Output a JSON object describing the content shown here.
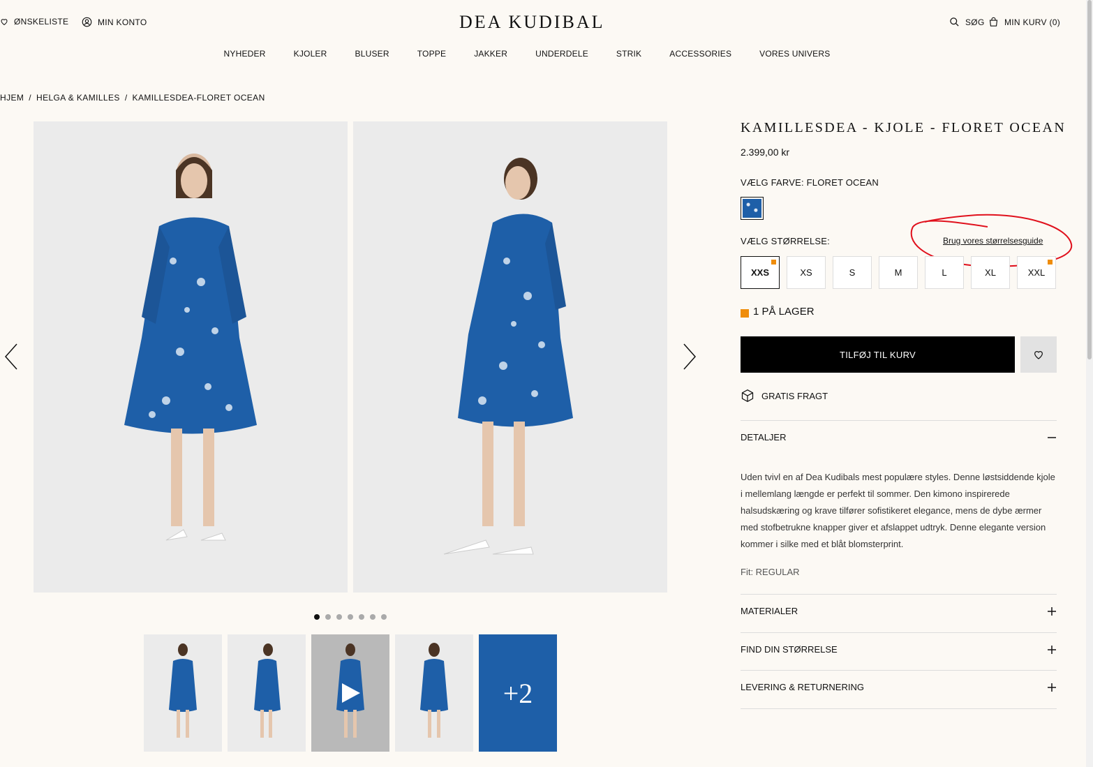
{
  "header": {
    "wishlist": "ØNSKELISTE",
    "account": "MIN KONTO",
    "logo": "DEA KUDIBAL",
    "search": "SØG",
    "cart": "MIN KURV (0)"
  },
  "nav": [
    "NYHEDER",
    "KJOLER",
    "BLUSER",
    "TOPPE",
    "JAKKER",
    "UNDERDELE",
    "STRIK",
    "ACCESSORIES",
    "VORES UNIVERS"
  ],
  "breadcrumb": [
    "HJEM",
    "HELGA & KAMILLES",
    "KAMILLESDEA-FLORET OCEAN"
  ],
  "gallery": {
    "total_dots": 7,
    "active_dot": 0,
    "more_count": "+2",
    "dress_color": "#1e5fa8"
  },
  "product": {
    "title": "KAMILLESDEA - KJOLE - FLORET OCEAN",
    "price": "2.399,00 kr",
    "color_label": "VÆLG FARVE: FLORET OCEAN",
    "size_label": "VÆLG STØRRELSE:",
    "size_guide": "Brug vores størrelsesguide",
    "sizes": [
      {
        "label": "XXS",
        "selected": true,
        "low_stock": true
      },
      {
        "label": "XS",
        "selected": false,
        "low_stock": false
      },
      {
        "label": "S",
        "selected": false,
        "low_stock": false
      },
      {
        "label": "M",
        "selected": false,
        "low_stock": false
      },
      {
        "label": "L",
        "selected": false,
        "low_stock": false
      },
      {
        "label": "XL",
        "selected": false,
        "low_stock": false
      },
      {
        "label": "XXL",
        "selected": false,
        "low_stock": true
      }
    ],
    "stock": "1 PÅ LAGER",
    "add_to_cart": "TILFØJ TIL KURV",
    "shipping": "GRATIS FRAGT",
    "details_heading": "DETALJER",
    "description": "Uden tvivl en af Dea Kudibals mest populære styles. Denne løstsiddende kjole i mellemlang længde er perfekt til sommer. Den kimono inspirerede halsudskæring og krave tilfører sofistikeret elegance, mens de dybe ærmer med stofbetrukne knapper giver et afslappet udtryk. Denne elegante version kommer i silke med et blåt blomsterprint.",
    "fit": "Fit: REGULAR",
    "accordions": [
      "MATERIALER",
      "FIND DIN STØRRELSE",
      "LEVERING & RETURNERING"
    ]
  },
  "colors": {
    "background": "#fcf9f4",
    "stock_orange": "#ef8d0b",
    "annotation_red": "#e0101c"
  }
}
